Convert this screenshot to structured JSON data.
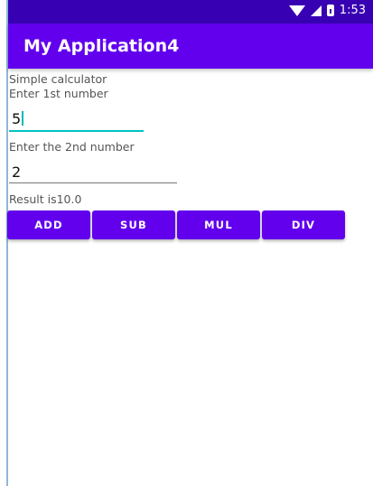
{
  "status_bar": {
    "time": "1:53"
  },
  "app_bar": {
    "title": "My Application4"
  },
  "content": {
    "heading": "Simple calculator",
    "label_first": "Enter 1st number",
    "input_first_value": "5",
    "label_second": "Enter the 2nd number",
    "input_second_value": "2",
    "result_text": "Result is10.0"
  },
  "buttons": [
    {
      "label": "ADD"
    },
    {
      "label": "SUB"
    },
    {
      "label": "MUL"
    },
    {
      "label": "DIV"
    }
  ],
  "colors": {
    "status_bar": "#3700b3",
    "primary": "#6200ee",
    "focus_underline": "#00c4c4"
  }
}
